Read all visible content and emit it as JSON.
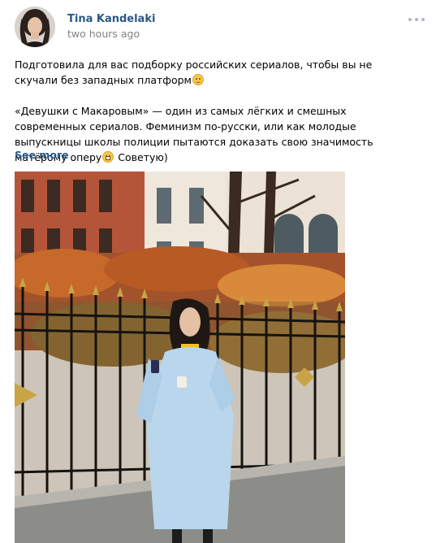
{
  "post": {
    "author": "Tina Kandelaki",
    "time": "two hours ago",
    "paragraph1": "Подготовила для вас подборку российских сериалов, чтобы вы не скучали без западных платформ",
    "paragraph2a": "«Девушки с Макаровым» — один из самых лёгких и смешных современных сериалов. Феминизм по-русски, или как молодые выпускницы школы полиции пытаются доказать свою значимость матёрому оперу",
    "paragraph2b": " Советую)",
    "see_more": "See more",
    "emoji1": "winking-face-icon",
    "emoji2": "grinning-face-icon"
  },
  "colors": {
    "link": "#2a5885",
    "muted": "#828282",
    "menu_dots": "#aeb7c2"
  }
}
